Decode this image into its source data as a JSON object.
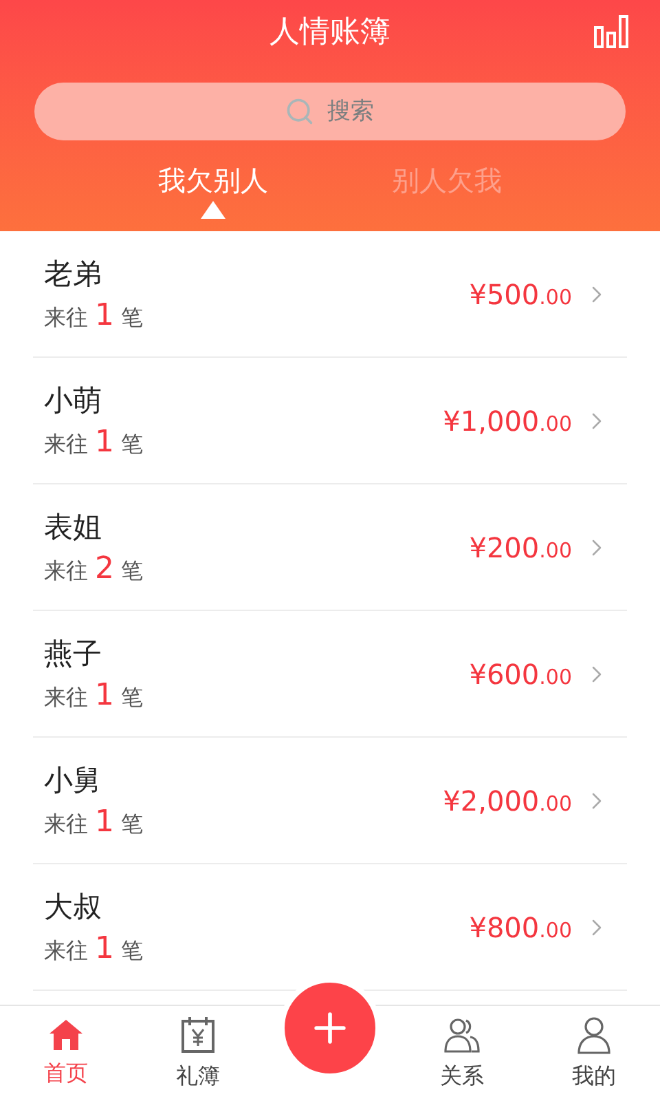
{
  "header": {
    "title": "人情账簿"
  },
  "search": {
    "placeholder": "搜索"
  },
  "tabs": [
    {
      "label": "我欠别人",
      "selected": true
    },
    {
      "label": "别人欠我",
      "selected": false
    }
  ],
  "entries": [
    {
      "name": "老弟",
      "prefix": "来往",
      "count": "1",
      "suffix": "笔",
      "amount": "¥500",
      "cents": ".00"
    },
    {
      "name": "小萌",
      "prefix": "来往",
      "count": "1",
      "suffix": "笔",
      "amount": "¥1,000",
      "cents": ".00"
    },
    {
      "name": "表姐",
      "prefix": "来往",
      "count": "2",
      "suffix": "笔",
      "amount": "¥200",
      "cents": ".00"
    },
    {
      "name": "燕子",
      "prefix": "来往",
      "count": "1",
      "suffix": "笔",
      "amount": "¥600",
      "cents": ".00"
    },
    {
      "name": "小舅",
      "prefix": "来往",
      "count": "1",
      "suffix": "笔",
      "amount": "¥2,000",
      "cents": ".00"
    },
    {
      "name": "大叔",
      "prefix": "来往",
      "count": "1",
      "suffix": "笔",
      "amount": "¥800",
      "cents": ".00"
    }
  ],
  "nav": [
    {
      "kind": "home",
      "label": "首页",
      "selected": true
    },
    {
      "kind": "book",
      "label": "礼簿",
      "selected": false
    },
    {
      "kind": "add"
    },
    {
      "kind": "relations",
      "label": "关系",
      "selected": false
    },
    {
      "kind": "me",
      "label": "我的",
      "selected": false
    }
  ]
}
